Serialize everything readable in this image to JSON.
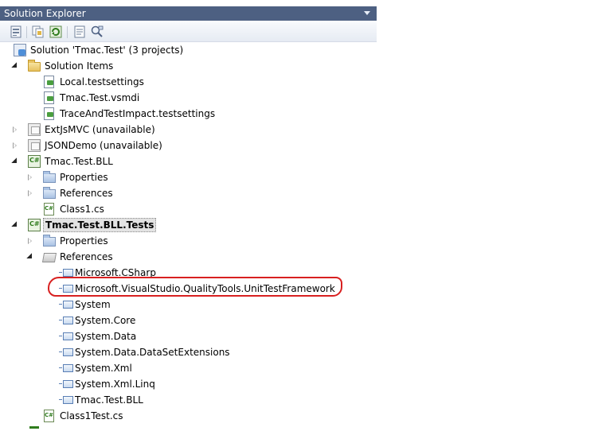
{
  "window": {
    "title": "Solution Explorer"
  },
  "toolbar": {
    "buttons": [
      "properties-icon",
      "show-all-files-icon",
      "refresh-icon",
      "view-code-icon",
      "view-class-diagram-icon"
    ]
  },
  "tree": {
    "solution": "Solution 'Tmac.Test' (3 projects)",
    "solution_items": "Solution Items",
    "local_testsettings": "Local.testsettings",
    "vsmdi": "Tmac.Test.vsmdi",
    "trace_testsettings": "TraceAndTestImpact.testsettings",
    "extjsmvc": "ExtJsMVC (unavailable)",
    "jsondemo": "JSONDemo (unavailable)",
    "bll": "Tmac.Test.BLL",
    "bll_properties": "Properties",
    "bll_references": "References",
    "class1": "Class1.cs",
    "bll_tests": "Tmac.Test.BLL.Tests",
    "tests_properties": "Properties",
    "tests_references": "References",
    "refs": [
      "Microsoft.CSharp",
      "Microsoft.VisualStudio.QualityTools.UnitTestFramework",
      "System",
      "System.Core",
      "System.Data",
      "System.Data.DataSetExtensions",
      "System.Xml",
      "System.Xml.Linq",
      "Tmac.Test.BLL"
    ],
    "class1test": "Class1Test.cs"
  },
  "colors": {
    "titlebar": "#4d6082",
    "annotation": "#d82020"
  }
}
